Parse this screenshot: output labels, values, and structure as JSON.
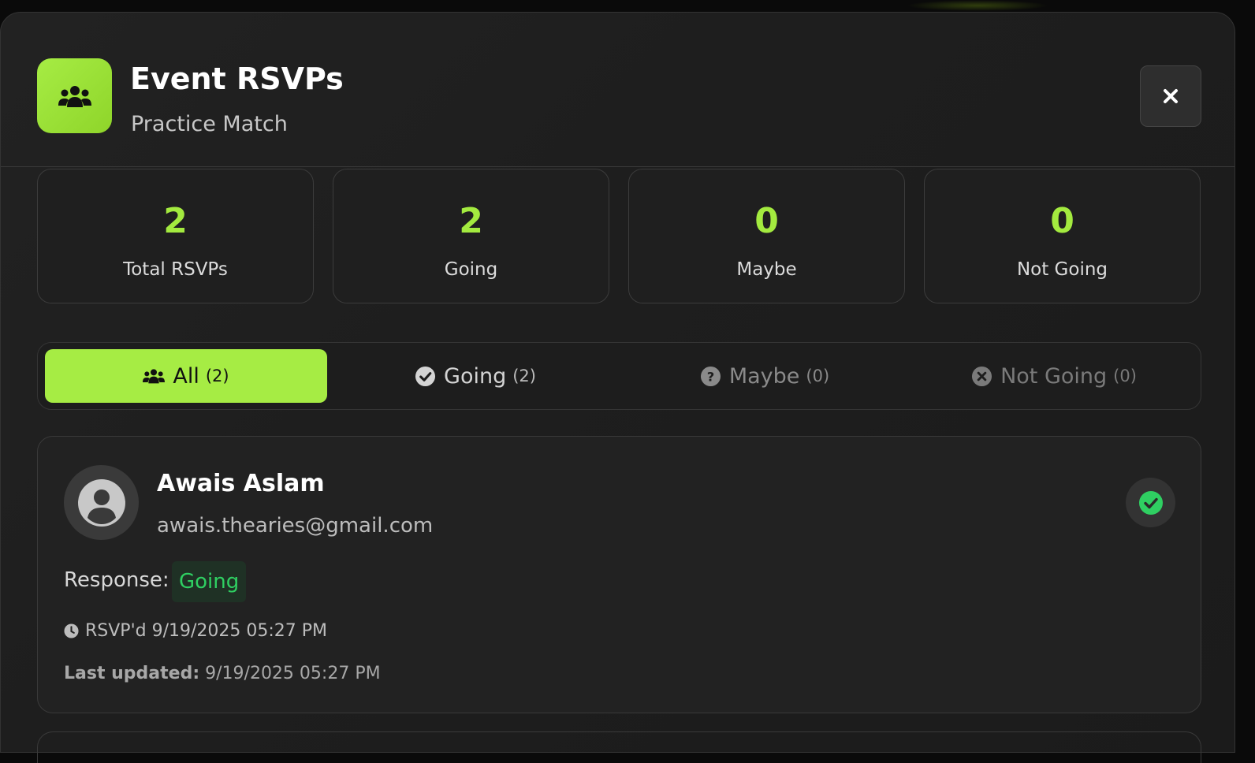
{
  "header": {
    "icon": "users-icon",
    "title": "Event RSVPs",
    "subtitle": "Practice Match",
    "close_icon": "close-icon"
  },
  "stats": [
    {
      "value": "2",
      "label": "Total RSVPs"
    },
    {
      "value": "2",
      "label": "Going"
    },
    {
      "value": "0",
      "label": "Maybe"
    },
    {
      "value": "0",
      "label": "Not Going"
    }
  ],
  "tabs": [
    {
      "label": "All",
      "count": "(2)",
      "icon": "users-icon",
      "active": true
    },
    {
      "label": "Going",
      "count": "(2)",
      "icon": "check-circle-icon",
      "active": false
    },
    {
      "label": "Maybe",
      "count": "(0)",
      "icon": "question-circle-icon",
      "active": false
    },
    {
      "label": "Not Going",
      "count": "(0)",
      "icon": "x-circle-icon",
      "active": false
    }
  ],
  "rsvps": [
    {
      "name": "Awais Aslam",
      "email": "awais.thearies@gmail.com",
      "response_label": "Response:",
      "response": "Going",
      "rsvpd": "RSVP'd 9/19/2025 05:27 PM",
      "updated_label": "Last updated:",
      "updated_value": "9/19/2025 05:27 PM",
      "status_icon": "check-circle-icon"
    }
  ],
  "colors": {
    "accent": "#a6ec44",
    "stat_value": "#a3ea3f",
    "going_green": "#2fcf62",
    "background": "#1e1e1e"
  }
}
